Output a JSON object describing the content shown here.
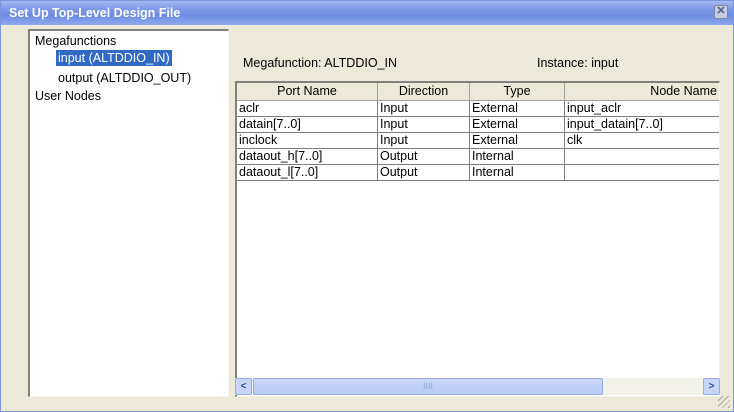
{
  "window": {
    "title": "Set Up Top-Level Design File",
    "close_symbol": "✕"
  },
  "tree": {
    "items": [
      {
        "label": "Megafunctions",
        "selected": false
      },
      {
        "label": "input (ALTDDIO_IN)",
        "selected": true
      },
      {
        "label": "output (ALTDDIO_OUT)",
        "selected": false
      },
      {
        "label": "User Nodes",
        "selected": false
      }
    ]
  },
  "header": {
    "megafunction": "Megafunction: ALTDDIO_IN",
    "instance": "Instance: input"
  },
  "table": {
    "columns": [
      "Port Name",
      "Direction",
      "Type",
      "Node Name"
    ],
    "rows": [
      [
        "aclr",
        "Input",
        "External",
        "input_aclr"
      ],
      [
        "datain[7..0]",
        "Input",
        "External",
        "input_datain[7..0]"
      ],
      [
        "inclock",
        "Input",
        "External",
        "clk"
      ],
      [
        "dataout_h[7..0]",
        "Output",
        "Internal",
        ""
      ],
      [
        "dataout_l[7..0]",
        "Output",
        "Internal",
        ""
      ]
    ]
  },
  "scrollbar": {
    "left_arrow": "<",
    "right_arrow": ">",
    "thumb_grip": "IIII"
  },
  "colors": {
    "title_bar": "#7b97e6",
    "selection": "#316ac5",
    "dialog_bg": "#ece9d8"
  }
}
